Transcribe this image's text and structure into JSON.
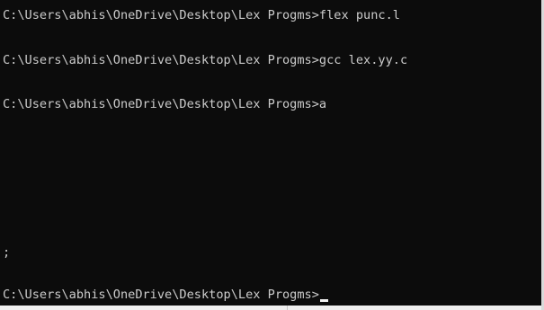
{
  "terminal": {
    "lines": [
      "C:\\Users\\abhis\\OneDrive\\Desktop\\Lex Progms>flex punc.l",
      "C:\\Users\\abhis\\OneDrive\\Desktop\\Lex Progms>gcc lex.yy.c",
      "C:\\Users\\abhis\\OneDrive\\Desktop\\Lex Progms>a",
      ";"
    ],
    "prompt": "C:\\Users\\abhis\\OneDrive\\Desktop\\Lex Progms>",
    "colors": {
      "background": "#0c0c0c",
      "text": "#cccccc",
      "cursor": "#f2f2f2"
    },
    "cursor_icon": "block-cursor"
  }
}
